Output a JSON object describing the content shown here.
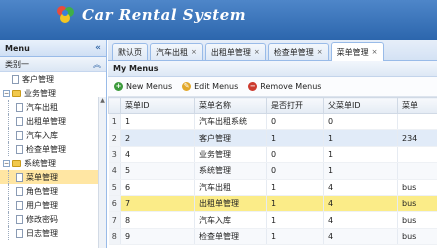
{
  "app": {
    "title": "Car Rental System"
  },
  "sidebar": {
    "title": "Menu",
    "collapse_icon": "double-chevron-left-icon",
    "group_label": "类别一",
    "group_toggle_icon": "double-chevron-up-icon",
    "tree": [
      {
        "label": "客户管理",
        "level": 0,
        "type": "file"
      },
      {
        "label": "业务管理",
        "level": 0,
        "type": "folder",
        "expanded": true
      },
      {
        "label": "汽车出租",
        "level": 1,
        "type": "file"
      },
      {
        "label": "出租单管理",
        "level": 1,
        "type": "file"
      },
      {
        "label": "汽车入库",
        "level": 1,
        "type": "file"
      },
      {
        "label": "检查单管理",
        "level": 1,
        "type": "file"
      },
      {
        "label": "系统管理",
        "level": 0,
        "type": "folder",
        "expanded": true
      },
      {
        "label": "菜单管理",
        "level": 1,
        "type": "file",
        "selected": true
      },
      {
        "label": "角色管理",
        "level": 1,
        "type": "file"
      },
      {
        "label": "用户管理",
        "level": 1,
        "type": "file"
      },
      {
        "label": "修改密码",
        "level": 1,
        "type": "file"
      },
      {
        "label": "日志管理",
        "level": 1,
        "type": "file"
      }
    ]
  },
  "tabs": [
    {
      "label": "默认页",
      "closable": false,
      "active": false
    },
    {
      "label": "汽车出租",
      "closable": true,
      "active": false
    },
    {
      "label": "出租单管理",
      "closable": true,
      "active": false
    },
    {
      "label": "检查单管理",
      "closable": true,
      "active": false
    },
    {
      "label": "菜单管理",
      "closable": true,
      "active": true
    }
  ],
  "panel": {
    "title": "My Menus"
  },
  "toolbar": {
    "new_label": "New Menus",
    "edit_label": "Edit Menus",
    "remove_label": "Remove Menus"
  },
  "grid": {
    "columns": [
      "菜单ID",
      "菜单名称",
      "是否打开",
      "父菜单ID",
      "菜单"
    ],
    "rows": [
      {
        "rn": "1",
        "cells": [
          "1",
          "汽车出租系统",
          "0",
          "0",
          ""
        ]
      },
      {
        "rn": "2",
        "cells": [
          "2",
          "客户管理",
          "1",
          "1",
          "234"
        ],
        "state": "hover"
      },
      {
        "rn": "3",
        "cells": [
          "4",
          "业务管理",
          "0",
          "1",
          ""
        ]
      },
      {
        "rn": "4",
        "cells": [
          "5",
          "系统管理",
          "0",
          "1",
          ""
        ]
      },
      {
        "rn": "5",
        "cells": [
          "6",
          "汽车出租",
          "1",
          "4",
          "bus"
        ]
      },
      {
        "rn": "6",
        "cells": [
          "7",
          "出租单管理",
          "1",
          "4",
          "bus"
        ],
        "state": "selected"
      },
      {
        "rn": "7",
        "cells": [
          "8",
          "汽车入库",
          "1",
          "4",
          "bus"
        ]
      },
      {
        "rn": "8",
        "cells": [
          "9",
          "检查单管理",
          "1",
          "4",
          "bus"
        ]
      }
    ]
  },
  "colors": {
    "header_blue": "#2c66ad",
    "selected_row": "#fbec88",
    "selected_tree": "#ffe6a3"
  }
}
